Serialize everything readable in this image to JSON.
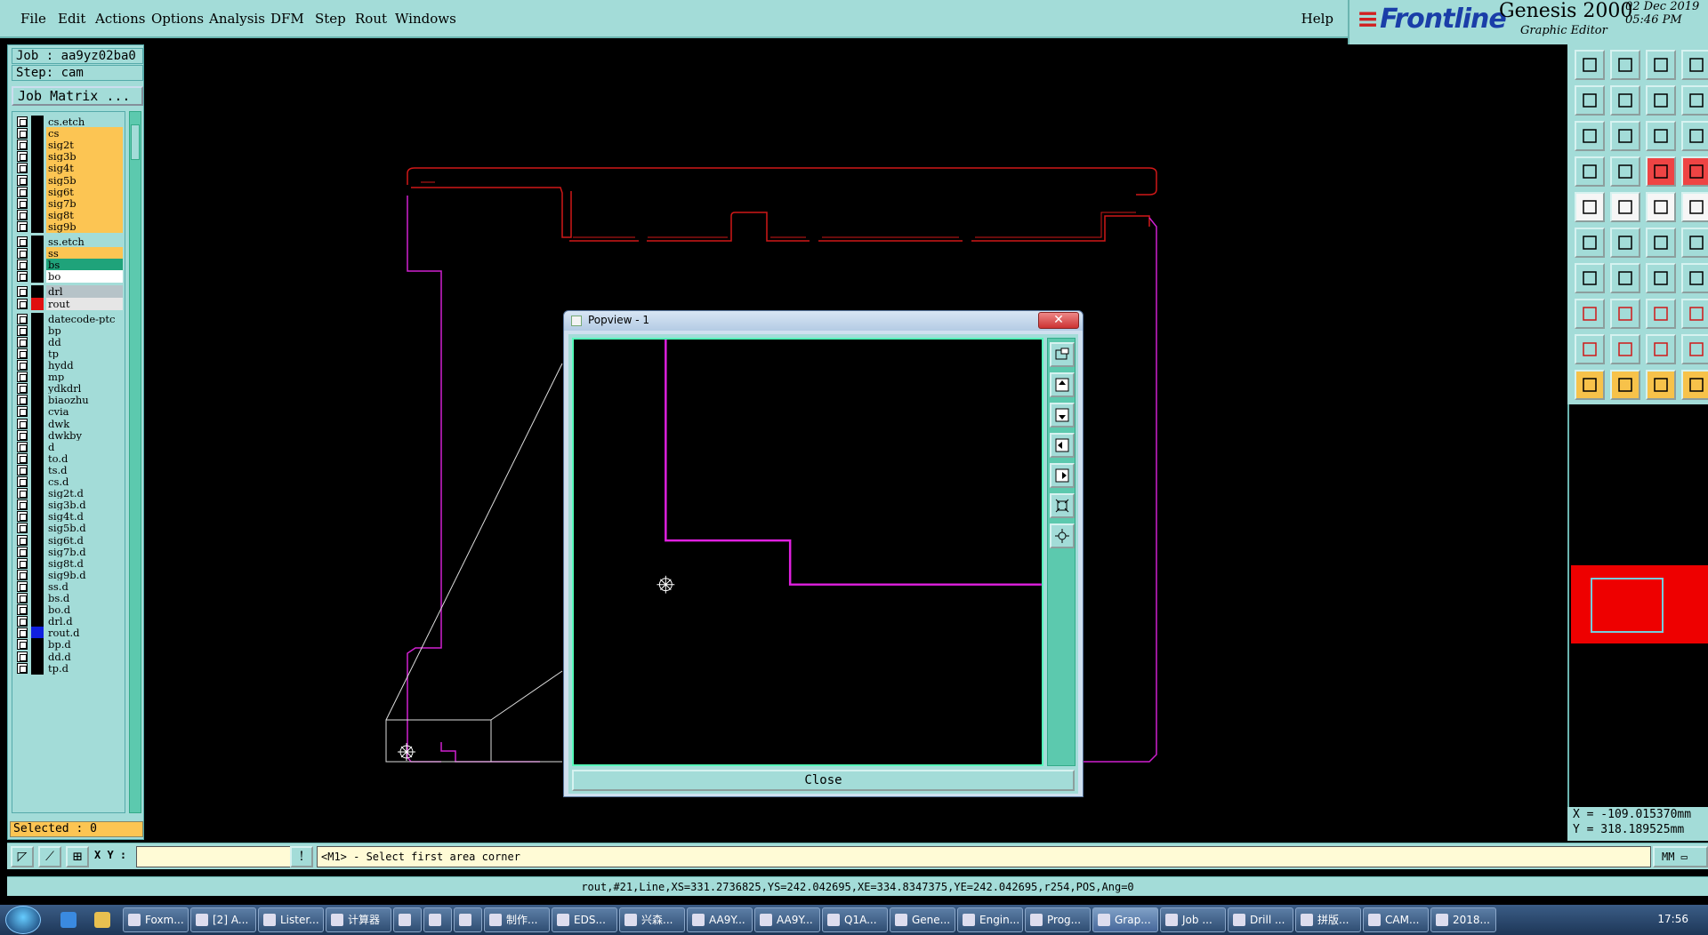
{
  "menu": [
    "File",
    "Edit",
    "Actions",
    "Options",
    "Analysis",
    "DFM",
    "Step",
    "Rout",
    "Windows"
  ],
  "help": "Help",
  "brand": {
    "logo": "Frontline",
    "product": "Genesis 2000",
    "subtitle": "Graphic Editor",
    "date": "02 Dec 2019",
    "time": "05:46 PM"
  },
  "job": {
    "job_label": "Job : aa9yz02ba0",
    "step_label": "Step: cam",
    "matrix_button": "Job Matrix ..."
  },
  "layers": [
    {
      "name": "cs.etch",
      "color": "#a3dcd8"
    },
    {
      "name": "cs",
      "color": "#fcc553"
    },
    {
      "name": "sig2t",
      "color": "#fcc553"
    },
    {
      "name": "sig3b",
      "color": "#fcc553"
    },
    {
      "name": "sig4t",
      "color": "#fcc553"
    },
    {
      "name": "sig5b",
      "color": "#fcc553"
    },
    {
      "name": "sig6t",
      "color": "#fcc553"
    },
    {
      "name": "sig7b",
      "color": "#fcc553"
    },
    {
      "name": "sig8t",
      "color": "#fcc553"
    },
    {
      "name": "sig9b",
      "color": "#fcc553"
    },
    {
      "name": "ss.etch",
      "color": "#a3dcd8"
    },
    {
      "name": "ss",
      "color": "#fcc553"
    },
    {
      "name": "bs",
      "color": "#1fa37a"
    },
    {
      "name": "bo",
      "color": "#ffffff"
    },
    {
      "name": "drl",
      "color": "#b6c3c8"
    },
    {
      "name": "rout",
      "color": "#e6e6e6"
    },
    {
      "name": "datecode-ptc",
      "color": "#a3dcd8"
    },
    {
      "name": "bp",
      "color": "#a3dcd8"
    },
    {
      "name": "dd",
      "color": "#a3dcd8"
    },
    {
      "name": "tp",
      "color": "#a3dcd8"
    },
    {
      "name": "hydd",
      "color": "#a3dcd8"
    },
    {
      "name": "mp",
      "color": "#a3dcd8"
    },
    {
      "name": "ydkdrl",
      "color": "#a3dcd8"
    },
    {
      "name": "biaozhu",
      "color": "#a3dcd8"
    },
    {
      "name": "cvia",
      "color": "#a3dcd8"
    },
    {
      "name": "dwk",
      "color": "#a3dcd8"
    },
    {
      "name": "dwkby",
      "color": "#a3dcd8"
    },
    {
      "name": "d",
      "color": "#a3dcd8"
    },
    {
      "name": "to.d",
      "color": "#a3dcd8"
    },
    {
      "name": "ts.d",
      "color": "#a3dcd8"
    },
    {
      "name": "cs.d",
      "color": "#a3dcd8"
    },
    {
      "name": "sig2t.d",
      "color": "#a3dcd8"
    },
    {
      "name": "sig3b.d",
      "color": "#a3dcd8"
    },
    {
      "name": "sig4t.d",
      "color": "#a3dcd8"
    },
    {
      "name": "sig5b.d",
      "color": "#a3dcd8"
    },
    {
      "name": "sig6t.d",
      "color": "#a3dcd8"
    },
    {
      "name": "sig7b.d",
      "color": "#a3dcd8"
    },
    {
      "name": "sig8t.d",
      "color": "#a3dcd8"
    },
    {
      "name": "sig9b.d",
      "color": "#a3dcd8"
    },
    {
      "name": "ss.d",
      "color": "#a3dcd8"
    },
    {
      "name": "bs.d",
      "color": "#a3dcd8"
    },
    {
      "name": "bo.d",
      "color": "#a3dcd8"
    },
    {
      "name": "drl.d",
      "color": "#a3dcd8"
    },
    {
      "name": "rout.d",
      "color": "#a3dcd8"
    },
    {
      "name": "bp.d",
      "color": "#a3dcd8"
    },
    {
      "name": "dd.d",
      "color": "#a3dcd8"
    },
    {
      "name": "tp.d",
      "color": "#a3dcd8"
    }
  ],
  "selected_label": "Selected : 0",
  "coords": {
    "x": "X = -109.015370mm",
    "y": "Y = 318.189525mm"
  },
  "command": {
    "xy_label": "X Y :",
    "xy_value": "",
    "prompt": "<M1> - Select first area corner",
    "units": "MM"
  },
  "status_line": "rout,#21,Line,XS=331.2736825,YS=242.042695,XE=334.8347375,YE=242.042695,r254,POS,Ang=0",
  "popview": {
    "title": "Popview - 1",
    "close_label": "Close"
  },
  "taskbar": {
    "items": [
      "Foxm...",
      "[2] A...",
      "Lister...",
      "计算器",
      "",
      "",
      "",
      "制作...",
      "EDS...",
      "兴森...",
      "AA9Y...",
      "AA9Y...",
      "Q1A...",
      "Gene...",
      "Engin...",
      "Prog...",
      "Grap...",
      "Job ...",
      "Drill ...",
      "拼版...",
      "CAM...",
      "2018..."
    ],
    "clock": "17:56"
  },
  "colors": {
    "panel": "#a3dcd8",
    "teal": "#5cc9ae",
    "layer_yellow": "#fcc553",
    "rout_magenta": "#e020e0",
    "board_red": "#d01818"
  }
}
